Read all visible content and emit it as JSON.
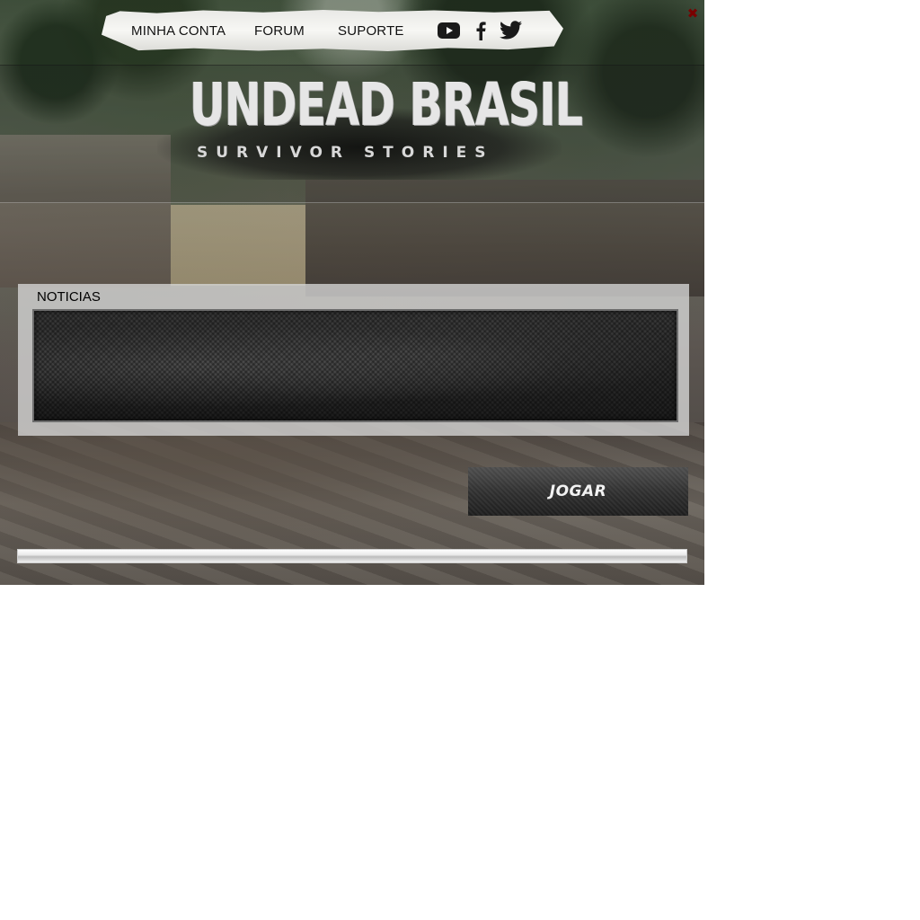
{
  "close_button": {
    "glyph": "✖"
  },
  "nav": {
    "links": [
      "MINHA CONTA",
      "FORUM",
      "SUPORTE"
    ],
    "social_icons": [
      "youtube-icon",
      "facebook-icon",
      "twitter-icon"
    ]
  },
  "logo": {
    "title": "UNDEAD BRASIL",
    "subtitle": "SURVIVOR STORIES"
  },
  "news": {
    "title": "NOTICIAS"
  },
  "play_button": {
    "label": "JOGAR"
  },
  "progress": {
    "value": 0
  },
  "colors": {
    "close": "#7a0000",
    "nav_text": "#111111",
    "button_bg": "#2e2e2e",
    "button_text": "#f2f2f2"
  }
}
